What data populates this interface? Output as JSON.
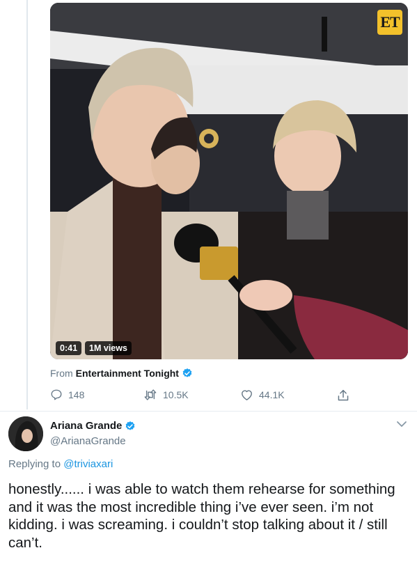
{
  "video": {
    "duration": "0:41",
    "views": "1M views",
    "brand_badge": "ET"
  },
  "source": {
    "prefix": "From",
    "name": "Entertainment Tonight"
  },
  "actions": {
    "replies": "148",
    "retweets": "10.5K",
    "likes": "44.1K"
  },
  "reply_tweet": {
    "author_name": "Ariana Grande",
    "author_handle": "@ArianaGrande",
    "replying_prefix": "Replying to",
    "replying_to": "@triviaxari",
    "text": "honestly...... i was able to watch them rehearse for something and it was the most incredible thing i’ve ever seen. i’m not kidding. i was screaming. i couldn’t stop talking about it / still can’t."
  },
  "colors": {
    "verified": "#1da1f2",
    "muted": "#657786",
    "mention": "#1b95e0",
    "et_badge": "#f3c12b"
  }
}
